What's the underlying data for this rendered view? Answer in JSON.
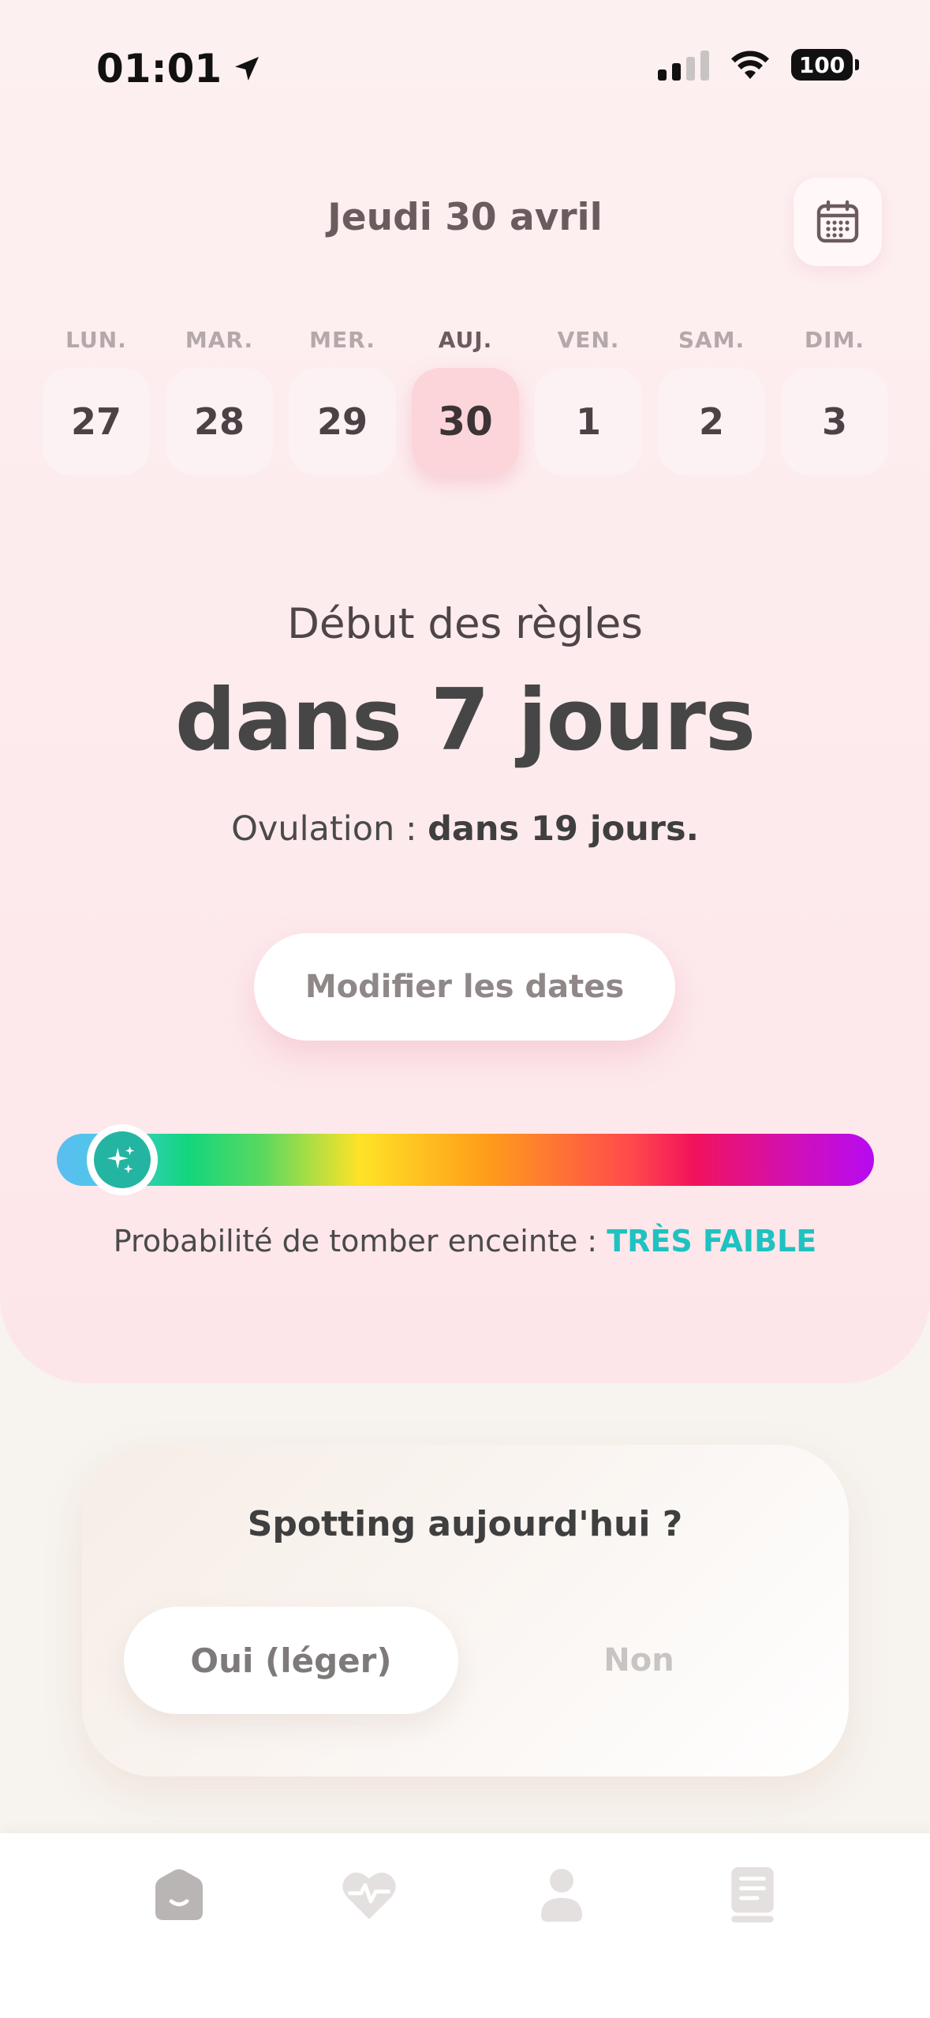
{
  "status_bar": {
    "time": "01:01",
    "battery": "100"
  },
  "header": {
    "date_title": "Jeudi 30 avril"
  },
  "week": [
    {
      "label": "LUN.",
      "num": "27",
      "today": false
    },
    {
      "label": "MAR.",
      "num": "28",
      "today": false
    },
    {
      "label": "MER.",
      "num": "29",
      "today": false
    },
    {
      "label": "AUJ.",
      "num": "30",
      "today": true
    },
    {
      "label": "VEN.",
      "num": "1",
      "today": false
    },
    {
      "label": "SAM.",
      "num": "2",
      "today": false
    },
    {
      "label": "DIM.",
      "num": "3",
      "today": false
    }
  ],
  "cycle": {
    "period_label": "Début des règles",
    "period_value": "dans 7 jours",
    "ovulation_prefix": "Ovulation : ",
    "ovulation_value": "dans 19 jours."
  },
  "modify_button": "Modifier les dates",
  "fertility": {
    "prefix": "Probabilité de tomber enceinte : ",
    "level": "TRÈS FAIBLE",
    "level_color": "#1fc2c0",
    "indicator_fraction": 0.08
  },
  "spotting": {
    "question": "Spotting aujourd'hui ?",
    "yes_label": "Oui (léger)",
    "no_label": "Non"
  },
  "tabs": [
    {
      "icon": "home-icon"
    },
    {
      "icon": "heart-pulse-icon"
    },
    {
      "icon": "profile-icon"
    },
    {
      "icon": "book-icon"
    }
  ]
}
